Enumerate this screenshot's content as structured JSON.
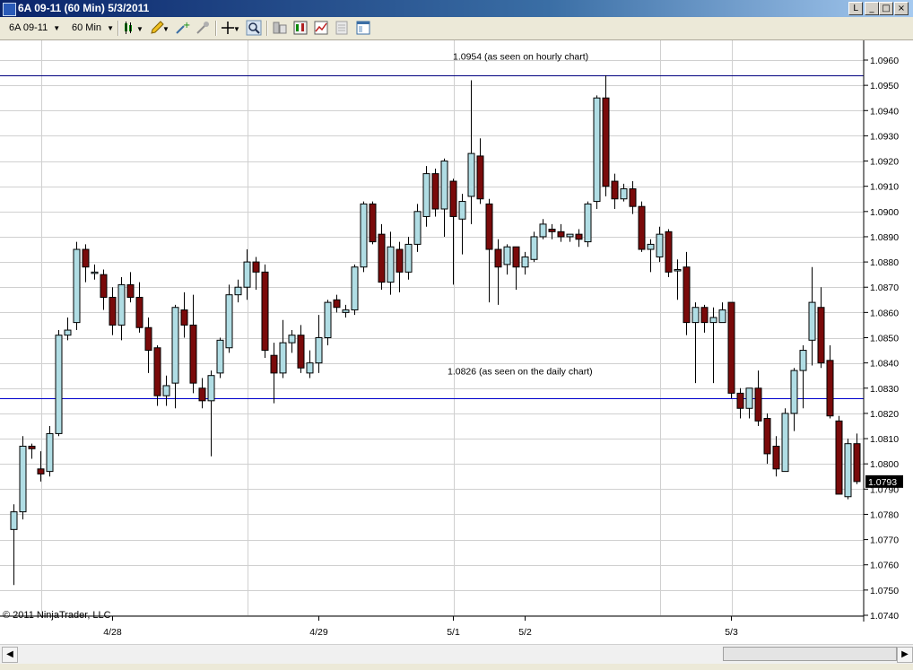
{
  "window": {
    "title": "6A 09-11 (60 Min)  5/3/2011"
  },
  "toolbar": {
    "instrument": "6A 09-11",
    "interval": "60 Min"
  },
  "chart_data": {
    "type": "candlestick",
    "ylim": [
      1.074,
      1.096
    ],
    "y_ticks": [
      "1.0960",
      "1.0950",
      "1.0940",
      "1.0930",
      "1.0920",
      "1.0910",
      "1.0900",
      "1.0890",
      "1.0880",
      "1.0870",
      "1.0860",
      "1.0850",
      "1.0840",
      "1.0830",
      "1.0820",
      "1.0810",
      "1.0800",
      "1.0790",
      "1.0780",
      "1.0770",
      "1.0760",
      "1.0750",
      "1.0740"
    ],
    "x_labels": [
      {
        "label": "4/28",
        "bar": 11
      },
      {
        "label": "4/29",
        "bar": 34
      },
      {
        "label": "5/1",
        "bar": 49
      },
      {
        "label": "5/2",
        "bar": 57
      },
      {
        "label": "5/3",
        "bar": 80
      }
    ],
    "vgrid_bars": [
      3,
      26,
      49,
      72,
      80
    ],
    "last_price": "1.0793",
    "hlines": [
      {
        "value": 1.0954,
        "color": "#000080",
        "label": "1.0954 (as seen on hourly chart)"
      },
      {
        "value": 1.0826,
        "color": "#0000cc",
        "label": "1.0826 (as seen on the daily chart)"
      }
    ],
    "copyright": "© 2011 NinjaTrader, LLC",
    "colors": {
      "up": "#b0dde4",
      "down": "#7a0a0a",
      "wick": "#000000"
    },
    "candles": [
      [
        1.0774,
        1.0784,
        1.0752,
        1.0781
      ],
      [
        1.0781,
        1.0811,
        1.0778,
        1.0807
      ],
      [
        1.0807,
        1.0808,
        1.0802,
        1.0806
      ],
      [
        1.0798,
        1.0805,
        1.0793,
        1.0796
      ],
      [
        1.0797,
        1.0815,
        1.0795,
        1.0812
      ],
      [
        1.0812,
        1.0853,
        1.0811,
        1.0851
      ],
      [
        1.0851,
        1.0858,
        1.0849,
        1.0853
      ],
      [
        1.0856,
        1.0888,
        1.0853,
        1.0885
      ],
      [
        1.0885,
        1.0887,
        1.0872,
        1.0878
      ],
      [
        1.0876,
        1.0879,
        1.0873,
        1.0876
      ],
      [
        1.0875,
        1.0877,
        1.0861,
        1.0866
      ],
      [
        1.0866,
        1.087,
        1.0851,
        1.0855
      ],
      [
        1.0855,
        1.0874,
        1.0849,
        1.0871
      ],
      [
        1.0871,
        1.0876,
        1.0864,
        1.0866
      ],
      [
        1.0866,
        1.0872,
        1.0852,
        1.0854
      ],
      [
        1.0854,
        1.0858,
        1.0836,
        1.0845
      ],
      [
        1.0846,
        1.0847,
        1.0823,
        1.0827
      ],
      [
        1.0827,
        1.0835,
        1.0823,
        1.0831
      ],
      [
        1.0832,
        1.0863,
        1.0822,
        1.0862
      ],
      [
        1.0861,
        1.0868,
        1.085,
        1.0855
      ],
      [
        1.0855,
        1.0867,
        1.0828,
        1.0832
      ],
      [
        1.083,
        1.0834,
        1.0822,
        1.0825
      ],
      [
        1.0825,
        1.0837,
        1.0803,
        1.0835
      ],
      [
        1.0836,
        1.085,
        1.0834,
        1.0849
      ],
      [
        1.0846,
        1.0871,
        1.0844,
        1.0867
      ],
      [
        1.0867,
        1.0873,
        1.0864,
        1.087
      ],
      [
        1.087,
        1.0885,
        1.0865,
        1.088
      ],
      [
        1.088,
        1.0882,
        1.0869,
        1.0876
      ],
      [
        1.0876,
        1.0879,
        1.0842,
        1.0845
      ],
      [
        1.0843,
        1.0848,
        1.0824,
        1.0836
      ],
      [
        1.0836,
        1.0857,
        1.0834,
        1.0848
      ],
      [
        1.0848,
        1.0853,
        1.0844,
        1.0851
      ],
      [
        1.0851,
        1.0855,
        1.0836,
        1.0838
      ],
      [
        1.0836,
        1.0845,
        1.0834,
        1.084
      ],
      [
        1.084,
        1.0859,
        1.0836,
        1.085
      ],
      [
        1.085,
        1.0865,
        1.0847,
        1.0864
      ],
      [
        1.0865,
        1.0867,
        1.086,
        1.0862
      ],
      [
        1.086,
        1.0863,
        1.0858,
        1.0861
      ],
      [
        1.0861,
        1.0879,
        1.0859,
        1.0878
      ],
      [
        1.0878,
        1.0904,
        1.0876,
        1.0903
      ],
      [
        1.0903,
        1.0904,
        1.0887,
        1.0888
      ],
      [
        1.0891,
        1.0895,
        1.0869,
        1.0872
      ],
      [
        1.0872,
        1.0892,
        1.0867,
        1.0886
      ],
      [
        1.0885,
        1.0888,
        1.0868,
        1.0876
      ],
      [
        1.0876,
        1.089,
        1.0873,
        1.0887
      ],
      [
        1.0887,
        1.0903,
        1.0884,
        1.09
      ],
      [
        1.0898,
        1.0918,
        1.0894,
        1.0915
      ],
      [
        1.0915,
        1.0917,
        1.0898,
        1.0901
      ],
      [
        1.0901,
        1.0921,
        1.089,
        1.092
      ],
      [
        1.0912,
        1.0913,
        1.0871,
        1.0898
      ],
      [
        1.0897,
        1.0907,
        1.0883,
        1.0904
      ],
      [
        1.0906,
        1.0952,
        1.0895,
        1.0923
      ],
      [
        1.0922,
        1.0929,
        1.0903,
        1.0905
      ],
      [
        1.0903,
        1.0905,
        1.0864,
        1.0885
      ],
      [
        1.0885,
        1.0889,
        1.0863,
        1.0878
      ],
      [
        1.0879,
        1.0887,
        1.0875,
        1.0886
      ],
      [
        1.0886,
        1.0886,
        1.0869,
        1.0878
      ],
      [
        1.0878,
        1.0884,
        1.0875,
        1.0882
      ],
      [
        1.0881,
        1.0892,
        1.088,
        1.089
      ],
      [
        1.089,
        1.0897,
        1.0889,
        1.0895
      ],
      [
        1.0893,
        1.0895,
        1.0889,
        1.0892
      ],
      [
        1.0892,
        1.0895,
        1.0888,
        1.089
      ],
      [
        1.089,
        1.0891,
        1.0888,
        1.0891
      ],
      [
        1.0891,
        1.0893,
        1.0886,
        1.0889
      ],
      [
        1.0888,
        1.0904,
        1.0886,
        1.0903
      ],
      [
        1.0904,
        1.0946,
        1.0901,
        1.0945
      ],
      [
        1.0945,
        1.0954,
        1.0906,
        1.091
      ],
      [
        1.0912,
        1.0915,
        1.0901,
        1.0905
      ],
      [
        1.0905,
        1.0911,
        1.0904,
        1.0909
      ],
      [
        1.0909,
        1.0912,
        1.0899,
        1.0902
      ],
      [
        1.0902,
        1.0904,
        1.0884,
        1.0885
      ],
      [
        1.0885,
        1.0889,
        1.0876,
        1.0887
      ],
      [
        1.0882,
        1.0894,
        1.088,
        1.0891
      ],
      [
        1.0892,
        1.0893,
        1.0874,
        1.0876
      ],
      [
        1.0877,
        1.0881,
        1.0865,
        1.0877
      ],
      [
        1.0878,
        1.0884,
        1.0851,
        1.0856
      ],
      [
        1.0856,
        1.0864,
        1.0832,
        1.0862
      ],
      [
        1.0862,
        1.0863,
        1.0852,
        1.0856
      ],
      [
        1.0856,
        1.0862,
        1.0832,
        1.0858
      ],
      [
        1.0856,
        1.0864,
        1.0856,
        1.0861
      ],
      [
        1.0864,
        1.0864,
        1.0826,
        1.0828
      ],
      [
        1.0828,
        1.083,
        1.0818,
        1.0822
      ],
      [
        1.0822,
        1.083,
        1.0818,
        1.083
      ],
      [
        1.083,
        1.0837,
        1.0815,
        1.0817
      ],
      [
        1.0818,
        1.082,
        1.08,
        1.0804
      ],
      [
        1.0807,
        1.0811,
        1.0795,
        1.0798
      ],
      [
        1.0797,
        1.0822,
        1.0797,
        1.082
      ],
      [
        1.082,
        1.0838,
        1.0813,
        1.0837
      ],
      [
        1.0837,
        1.0847,
        1.0822,
        1.0845
      ],
      [
        1.0849,
        1.0878,
        1.0839,
        1.0864
      ],
      [
        1.0862,
        1.087,
        1.0838,
        1.084
      ],
      [
        1.0841,
        1.0847,
        1.0818,
        1.0819
      ],
      [
        1.0817,
        1.0819,
        1.0803,
        1.0788
      ],
      [
        1.0787,
        1.081,
        1.0786,
        1.0808
      ],
      [
        1.0808,
        1.0812,
        1.0792,
        1.0793
      ]
    ]
  }
}
